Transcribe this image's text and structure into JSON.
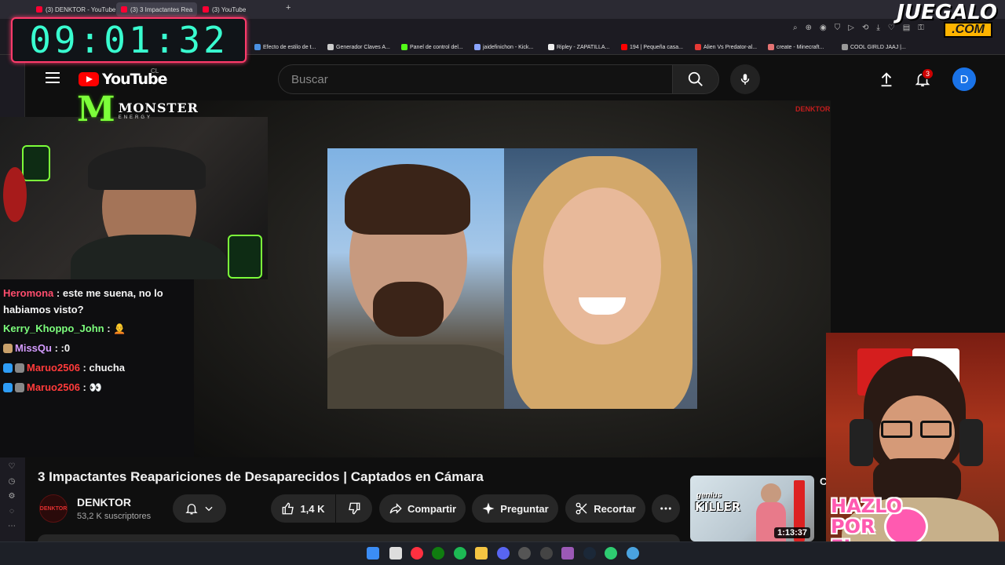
{
  "browser": {
    "tabs": [
      {
        "label": "(3) DENKTOR - YouTube"
      },
      {
        "label": "(3) 3 Impactantes Rea"
      },
      {
        "label": "(3) YouTube"
      }
    ],
    "new_tab_label": "+",
    "bookmarks": [
      {
        "label": "Efecto de estilo de t..."
      },
      {
        "label": "Generador Claves A..."
      },
      {
        "label": "Panel de control del..."
      },
      {
        "label": "jaidefinichon - Kick..."
      },
      {
        "label": "Ripley - ZAPATILLA..."
      },
      {
        "label": "194 | Pequeña casa..."
      },
      {
        "label": "Alien Vs Predator-al..."
      },
      {
        "label": "create - Minecraft..."
      },
      {
        "label": "COOL GIRLD JAAJ |..."
      }
    ]
  },
  "overlay": {
    "timer": "09:01:32",
    "juegalo_top": "JUEGALO",
    "juegalo_bottom": ".COM",
    "monster_name": "MONSTER",
    "monster_sub": "ENERGY",
    "hazlo_lines": [
      "HAZLO",
      "POR",
      "EL"
    ]
  },
  "youtube": {
    "logo_text": "YouTube",
    "country": "CL",
    "search_placeholder": "Buscar",
    "notification_count": "3",
    "account_initial": "D",
    "video_watermark": "DENKTOR",
    "video_title": "3 Impactantes Reapariciones de Desaparecidos | Captados en Cámara",
    "channel": {
      "name": "DENKTOR",
      "subscribers": "53,2 K suscriptores",
      "avatar_text": "DENKTOR"
    },
    "actions": {
      "likes": "1,4 K",
      "share": "Compartir",
      "ask": "Preguntar",
      "clip": "Recortar"
    },
    "recommended": {
      "thumb_line1": "genius",
      "thumb_line2": "KILLER",
      "duration": "1:13:37",
      "title_fragment": "C"
    }
  },
  "chat": [
    {
      "user": "Heromona",
      "message": ": este me suena, no lo habiamos visto?",
      "color": "#ff4d6d"
    },
    {
      "user": "Kerry_Khoppo_John",
      "message": ": 🧑‍🦲",
      "color": "#7dff7d"
    },
    {
      "user": "MissQu",
      "message": ": :0",
      "color": "#d59cff"
    },
    {
      "user": "Maruo2506",
      "message": ": chucha",
      "color": "#ff3b3b"
    },
    {
      "user": "Maruo2506",
      "message": ": 👀",
      "color": "#ff3b3b"
    }
  ],
  "colors": {
    "youtube_red": "#ff0000",
    "timer_text": "#39ffd0",
    "timer_border": "#ff3b6b",
    "monster_green": "#7cff3a",
    "account_blue": "#1a73e8"
  },
  "icons": [
    "menu-icon",
    "search-icon",
    "mic-icon",
    "upload-icon",
    "bell-icon",
    "like-icon",
    "dislike-icon",
    "share-icon",
    "sparkle-icon",
    "scissors-icon",
    "more-icon",
    "chevron-down-icon"
  ]
}
